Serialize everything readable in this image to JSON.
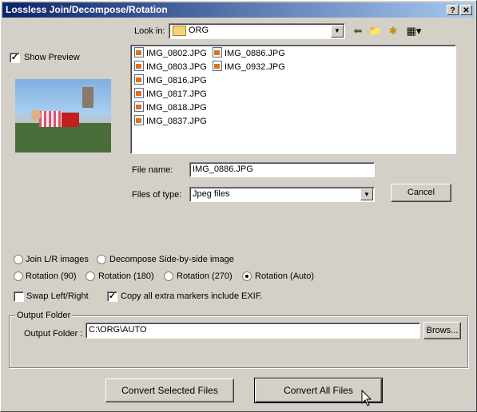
{
  "window": {
    "title": "Lossless Join/Decompose/Rotation"
  },
  "titlebar": {
    "help": "?",
    "close": "✕"
  },
  "lookin": {
    "label": "Look in:",
    "value": "ORG"
  },
  "preview": {
    "label": "Show Preview",
    "checked": true
  },
  "files": [
    "IMG_0802.JPG",
    "IMG_0803.JPG",
    "IMG_0816.JPG",
    "IMG_0817.JPG",
    "IMG_0818.JPG",
    "IMG_0837.JPG",
    "IMG_0886.JPG",
    "IMG_0932.JPG"
  ],
  "filename": {
    "label": "File name:",
    "value": "IMG_0886.JPG"
  },
  "filetype": {
    "label": "Files of type:",
    "value": "Jpeg files"
  },
  "cancel_label": "Cancel",
  "modes": {
    "join": "Join L/R images",
    "decompose": "Decompose Side-by-side image",
    "rot90": "Rotation (90)",
    "rot180": "Rotation (180)",
    "rot270": "Rotation (270)",
    "rotauto": "Rotation (Auto)",
    "selected": "Rotation (Auto)"
  },
  "options": {
    "swap": "Swap Left/Right",
    "copy": "Copy all extra markers include EXIF."
  },
  "output": {
    "group": "Output Folder",
    "label": "Output Folder :",
    "value": "C:\\ORG\\AUTO",
    "browse": "Brows..."
  },
  "actions": {
    "convert_selected": "Convert Selected Files",
    "convert_all": "Convert All Files"
  }
}
